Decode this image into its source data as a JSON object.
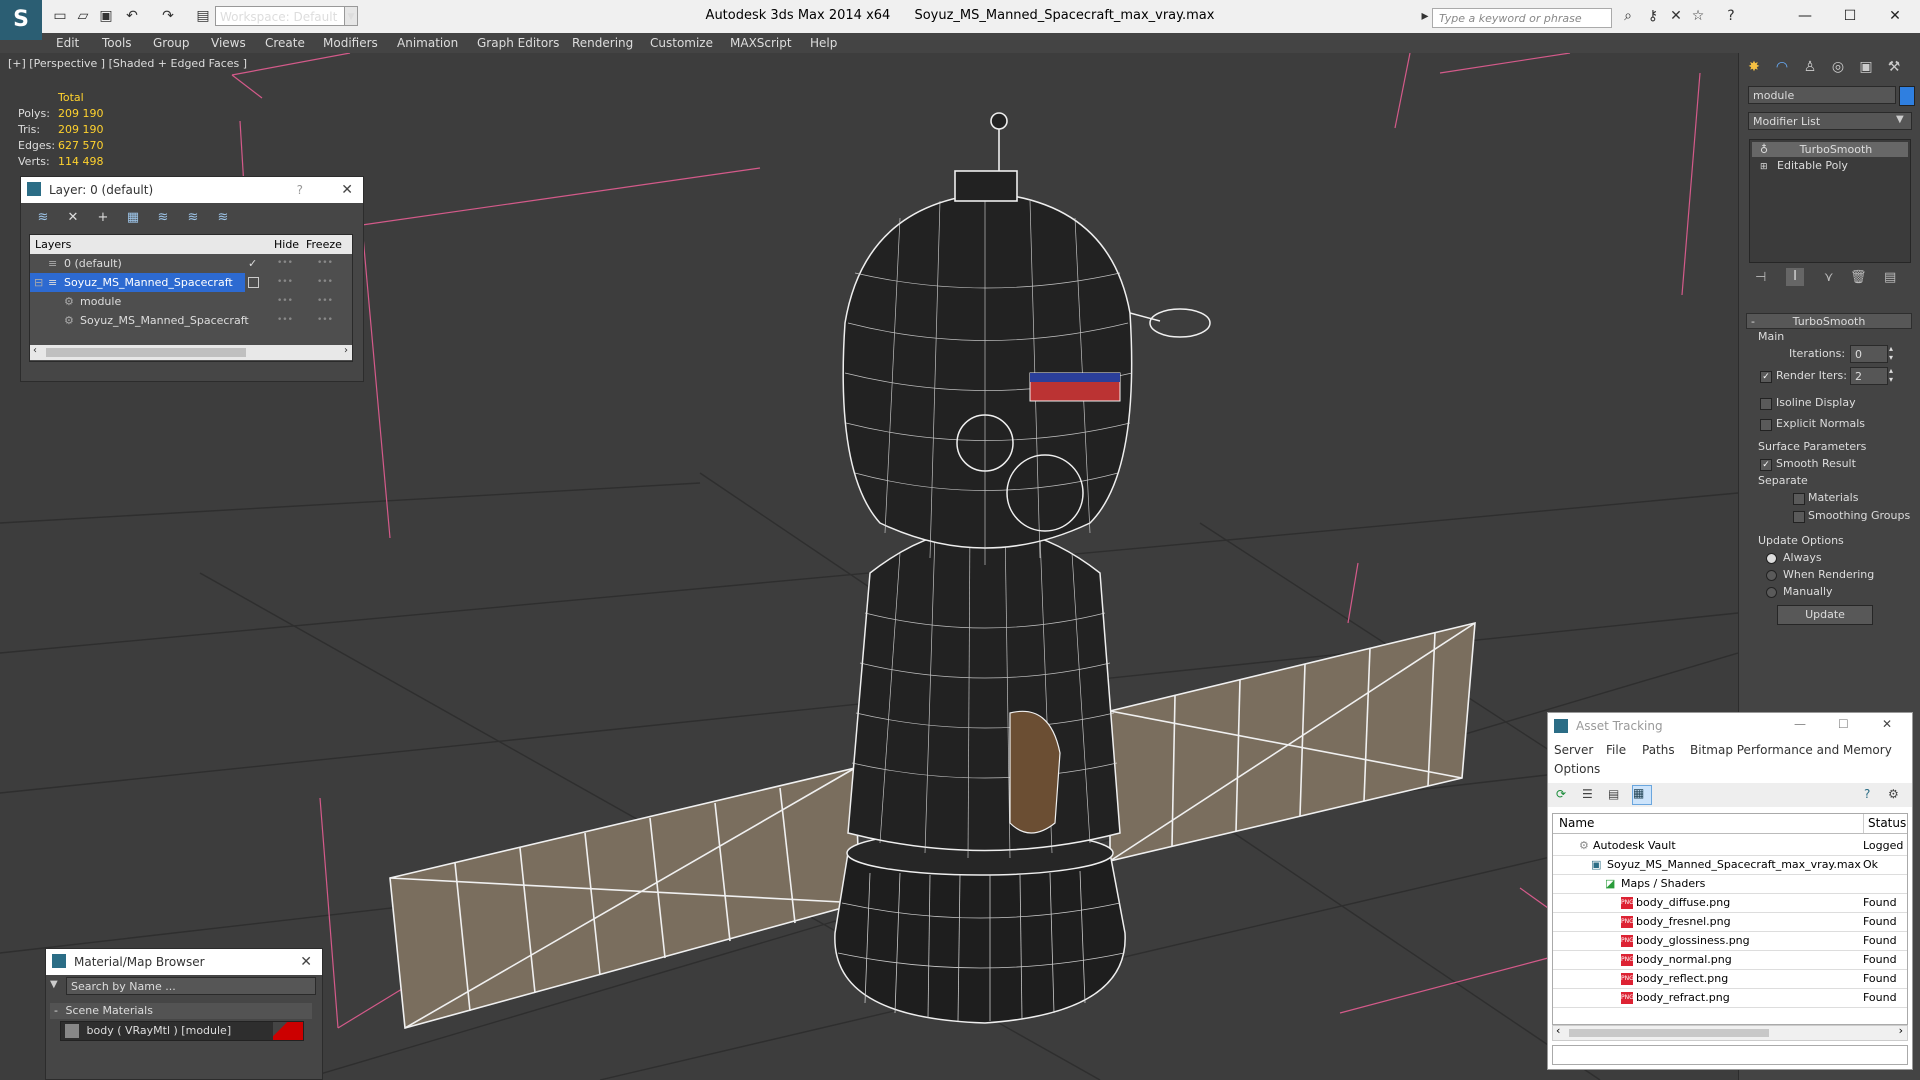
{
  "app": {
    "title": "Autodesk 3ds Max  2014 x64",
    "file": "Soyuz_MS_Manned_Spacecraft_max_vray.max",
    "workspace": "Workspace: Default",
    "search_placeholder": "Type a keyword or phrase"
  },
  "menu": [
    "Edit",
    "Tools",
    "Group",
    "Views",
    "Create",
    "Modifiers",
    "Animation",
    "Graph Editors",
    "Rendering",
    "Customize",
    "MAXScript",
    "Help"
  ],
  "viewport": {
    "label": "[+] [Perspective ] [Shaded + Edged Faces ]",
    "stats": {
      "header": "Total",
      "rows": [
        {
          "label": "Polys:",
          "value": "209 190"
        },
        {
          "label": "Tris:",
          "value": "209 190"
        },
        {
          "label": "Edges:",
          "value": "627 570"
        },
        {
          "label": "Verts:",
          "value": "114 498"
        }
      ]
    }
  },
  "layer_window": {
    "title": "Layer: 0 (default)",
    "help": "?",
    "columns": [
      "Layers",
      "Hide",
      "Freeze"
    ],
    "rows": [
      {
        "name": "0 (default)"
      },
      {
        "name": "Soyuz_MS_Manned_Spacecraft"
      },
      {
        "name": "module"
      },
      {
        "name": "Soyuz_MS_Manned_Spacecraft"
      }
    ]
  },
  "material_browser": {
    "title": "Material/Map Browser",
    "search_placeholder": "Search by Name ...",
    "section": "Scene Materials",
    "item": "body  ( VRayMtl ) [module]"
  },
  "command_panel": {
    "object_name": "module",
    "modifier_list": "Modifier List",
    "stack": [
      "TurboSmooth",
      "Editable Poly"
    ],
    "rollout_title": "TurboSmooth",
    "main_label": "Main",
    "iterations_label": "Iterations:",
    "iterations_value": "0",
    "render_iters_label": "Render Iters:",
    "render_iters_value": "2",
    "isoline": "Isoline Display",
    "explicit_normals": "Explicit Normals",
    "surface_params": "Surface Parameters",
    "smooth_result": "Smooth Result",
    "separate": "Separate",
    "materials": "Materials",
    "smoothing_groups": "Smoothing Groups",
    "update_options": "Update Options",
    "always": "Always",
    "when_rendering": "When Rendering",
    "manually": "Manually",
    "update_button": "Update"
  },
  "asset_tracking": {
    "title": "Asset Tracking",
    "menu": [
      "Server",
      "File",
      "Paths",
      "Bitmap Performance and Memory",
      "Options"
    ],
    "columns": [
      "Name",
      "Status"
    ],
    "rows": [
      {
        "name": "Autodesk Vault",
        "status": "Logged"
      },
      {
        "name": "Soyuz_MS_Manned_Spacecraft_max_vray.max",
        "status": "Ok"
      },
      {
        "name": "Maps / Shaders",
        "status": ""
      },
      {
        "name": "body_diffuse.png",
        "status": "Found"
      },
      {
        "name": "body_fresnel.png",
        "status": "Found"
      },
      {
        "name": "body_glossiness.png",
        "status": "Found"
      },
      {
        "name": "body_normal.png",
        "status": "Found"
      },
      {
        "name": "body_reflect.png",
        "status": "Found"
      },
      {
        "name": "body_refract.png",
        "status": "Found"
      }
    ]
  }
}
